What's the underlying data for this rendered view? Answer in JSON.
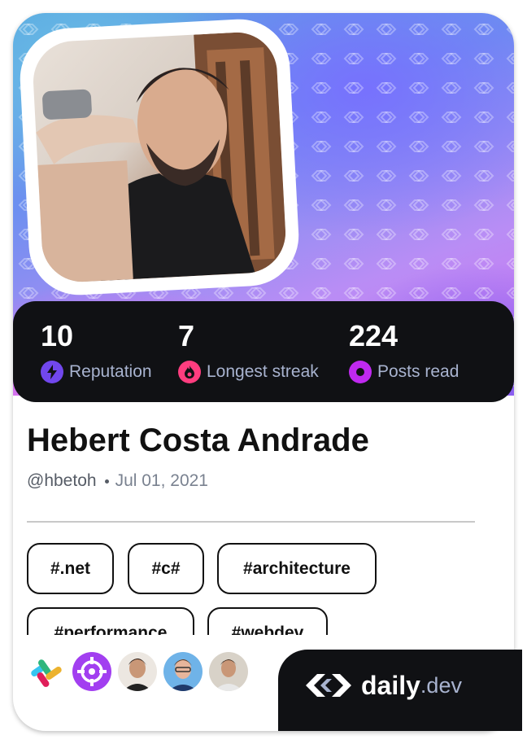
{
  "profile": {
    "name": "Hebert Costa Andrade",
    "handle": "@hbetoh",
    "joined": "Jul 01, 2021"
  },
  "stats": [
    {
      "value": "10",
      "label": "Reputation",
      "icon": "lightning-icon",
      "color": "#7147ed"
    },
    {
      "value": "7",
      "label": "Longest streak",
      "icon": "flame-icon",
      "color": "#ff3d7f"
    },
    {
      "value": "224",
      "label": "Posts read",
      "icon": "eye-ring-icon",
      "color": "#c029f0"
    }
  ],
  "tags": [
    "#.net",
    "#c#",
    "#architecture",
    "#performance",
    "#webdev"
  ],
  "squads": [
    "slack-logo-icon",
    "crosshair-logo-icon",
    "avatar",
    "avatar",
    "avatar"
  ],
  "brand": {
    "daily": "daily",
    "dev": ".dev"
  },
  "colors": {
    "card_dark": "#101114",
    "muted": "#a8b3cf",
    "text": "#111111"
  }
}
